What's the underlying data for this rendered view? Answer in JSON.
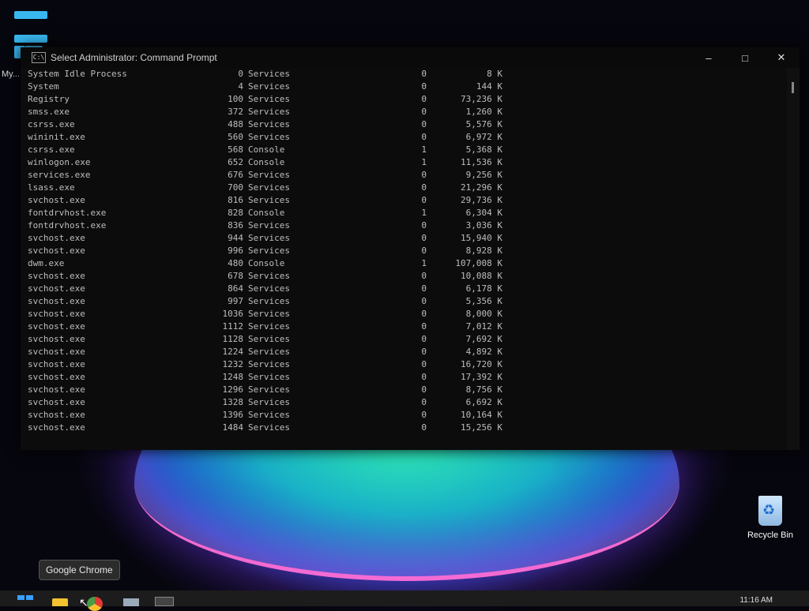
{
  "window": {
    "title": "Select Administrator: Command Prompt",
    "icon_label": "C:\\",
    "minimize_label": "–",
    "maximize_label": "□",
    "close_label": "✕"
  },
  "desktop": {
    "my_label": "My...",
    "recycle_bin_label": "Recycle Bin",
    "tooltip": "Google Chrome",
    "clock": "11:16 AM"
  },
  "tasklist": [
    {
      "name": "System Idle Process",
      "pid": "0",
      "session": "Services",
      "num": "0",
      "mem": "8 K"
    },
    {
      "name": "System",
      "pid": "4",
      "session": "Services",
      "num": "0",
      "mem": "144 K"
    },
    {
      "name": "Registry",
      "pid": "100",
      "session": "Services",
      "num": "0",
      "mem": "73,236 K"
    },
    {
      "name": "smss.exe",
      "pid": "372",
      "session": "Services",
      "num": "0",
      "mem": "1,260 K"
    },
    {
      "name": "csrss.exe",
      "pid": "488",
      "session": "Services",
      "num": "0",
      "mem": "5,576 K"
    },
    {
      "name": "wininit.exe",
      "pid": "560",
      "session": "Services",
      "num": "0",
      "mem": "6,972 K"
    },
    {
      "name": "csrss.exe",
      "pid": "568",
      "session": "Console",
      "num": "1",
      "mem": "5,368 K"
    },
    {
      "name": "winlogon.exe",
      "pid": "652",
      "session": "Console",
      "num": "1",
      "mem": "11,536 K"
    },
    {
      "name": "services.exe",
      "pid": "676",
      "session": "Services",
      "num": "0",
      "mem": "9,256 K"
    },
    {
      "name": "lsass.exe",
      "pid": "700",
      "session": "Services",
      "num": "0",
      "mem": "21,296 K"
    },
    {
      "name": "svchost.exe",
      "pid": "816",
      "session": "Services",
      "num": "0",
      "mem": "29,736 K"
    },
    {
      "name": "fontdrvhost.exe",
      "pid": "828",
      "session": "Console",
      "num": "1",
      "mem": "6,304 K"
    },
    {
      "name": "fontdrvhost.exe",
      "pid": "836",
      "session": "Services",
      "num": "0",
      "mem": "3,036 K"
    },
    {
      "name": "svchost.exe",
      "pid": "944",
      "session": "Services",
      "num": "0",
      "mem": "15,940 K"
    },
    {
      "name": "svchost.exe",
      "pid": "996",
      "session": "Services",
      "num": "0",
      "mem": "8,928 K"
    },
    {
      "name": "dwm.exe",
      "pid": "480",
      "session": "Console",
      "num": "1",
      "mem": "107,008 K"
    },
    {
      "name": "svchost.exe",
      "pid": "678",
      "session": "Services",
      "num": "0",
      "mem": "10,088 K"
    },
    {
      "name": "svchost.exe",
      "pid": "864",
      "session": "Services",
      "num": "0",
      "mem": "6,178 K"
    },
    {
      "name": "svchost.exe",
      "pid": "997",
      "session": "Services",
      "num": "0",
      "mem": "5,356 K"
    },
    {
      "name": "svchost.exe",
      "pid": "1036",
      "session": "Services",
      "num": "0",
      "mem": "8,000 K"
    },
    {
      "name": "svchost.exe",
      "pid": "1112",
      "session": "Services",
      "num": "0",
      "mem": "7,012 K"
    },
    {
      "name": "svchost.exe",
      "pid": "1128",
      "session": "Services",
      "num": "0",
      "mem": "7,692 K"
    },
    {
      "name": "svchost.exe",
      "pid": "1224",
      "session": "Services",
      "num": "0",
      "mem": "4,892 K"
    },
    {
      "name": "svchost.exe",
      "pid": "1232",
      "session": "Services",
      "num": "0",
      "mem": "16,720 K"
    },
    {
      "name": "svchost.exe",
      "pid": "1248",
      "session": "Services",
      "num": "0",
      "mem": "17,392 K"
    },
    {
      "name": "svchost.exe",
      "pid": "1296",
      "session": "Services",
      "num": "0",
      "mem": "8,756 K"
    },
    {
      "name": "svchost.exe",
      "pid": "1328",
      "session": "Services",
      "num": "0",
      "mem": "6,692 K"
    },
    {
      "name": "svchost.exe",
      "pid": "1396",
      "session": "Services",
      "num": "0",
      "mem": "10,164 K"
    },
    {
      "name": "svchost.exe",
      "pid": "1484",
      "session": "Services",
      "num": "0",
      "mem": "15,256 K"
    }
  ],
  "colors": {
    "console_bg": "#0c0c0c",
    "console_text": "#bdbdbd",
    "accent": "#3aa0ff"
  }
}
